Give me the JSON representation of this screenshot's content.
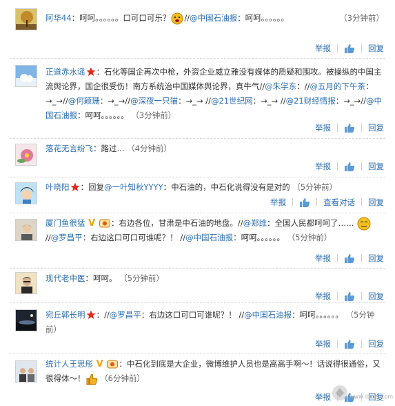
{
  "comments": [
    {
      "user": "阿华44",
      "text_a": "：呵呵。。。。。。口可口可乐？",
      "text_b": "//",
      "link1": "@中国石油报",
      "text_c": "：呵呵。。。。。。",
      "time": "（3分钟前）",
      "avatar": "tree-avatar",
      "actions": {
        "report": "举报",
        "reply": "回复"
      }
    },
    {
      "user": "正道赤水谣",
      "text": "：石化等国企再次中枪，外资企业威立雅没有媒体的质疑和围攻。被操纵的中国主流舆论界，国企很受伤！南方系统治中国媒体舆论界，真牛气//",
      "link1": "@朱学东",
      "s1": "：//",
      "link2": "@五月的下午茶",
      "s2": "：→_→//",
      "link3": "@何颖珊",
      "s3": "：→_→//",
      "link4": "@深夜一只猫",
      "s4": "：→_→ //",
      "link5": "@21世纪网",
      "s5": "：→_→ //",
      "link6": "@21财经情报",
      "s6": "：→_→//",
      "link7": "@中国石油报",
      "s7": "：呵呵。。。。。。",
      "time": "（3分钟前）",
      "avatar": "sky-avatar",
      "actions": {
        "report": "举报",
        "reply": "回复"
      }
    },
    {
      "user": "落花无言纷飞",
      "text": "：路过...",
      "time": "（4分钟前）",
      "avatar": "flower-avatar",
      "actions": {
        "report": "举报",
        "reply": "回复"
      }
    },
    {
      "user": "叶晓阳",
      "s0": "：回复",
      "link1": "@一叶知秋YYYY",
      "text": "：中石油的，中石化说得没有是对的",
      "time": "（5分钟前）",
      "avatar": "cartoon-avatar",
      "actions": {
        "report": "举报",
        "view": "查看对话",
        "reply": "回复"
      }
    },
    {
      "user": "厦门鱼很猛",
      "badge": "V",
      "s0": "：右边各位，甘肃是中石油的地盘。//",
      "link1": "@郑维",
      "s1": "：全国人民都呵呵了……",
      "s2": "//",
      "link2": "@罗昌平",
      "s3": "：右边这口可口可谁呢？！ //",
      "link3": "@中国石油报",
      "s4": "：呵呵。。。。。。",
      "time": "（5分钟前）",
      "avatar": "person-avatar",
      "actions": {
        "report": "举报",
        "reply": "回复"
      }
    },
    {
      "user": "现代老中医",
      "text": "：呵呵。",
      "time": "（5分钟前）",
      "avatar": "man-avatar",
      "actions": {
        "report": "举报",
        "reply": "回复"
      }
    },
    {
      "user": "宛丘郭长明",
      "s0": "：//",
      "link1": "@罗昌平",
      "s1": "：右边这口可口可谁呢？！ //",
      "link2": "@中国石油报",
      "s2": "：呵呵。。。。。。",
      "time": "（5分钟前）",
      "avatar": "night-avatar",
      "actions": {
        "report": "举报",
        "reply": "回复"
      }
    },
    {
      "user": "统计人王思彤",
      "badge": "V",
      "text": "：中石化到底是大企业，微博维护人员也是高高手啊～！话说得很通俗，又很得体～！",
      "time": "（6分钟前）",
      "avatar": "group-avatar",
      "actions": {
        "report": "举报",
        "reply": "回复"
      }
    }
  ],
  "watermark": "www.dxbei.com",
  "colors": {
    "link": "#2a6db0",
    "text": "#333333",
    "badge": "#e8a400",
    "star": "#e02a1a"
  }
}
